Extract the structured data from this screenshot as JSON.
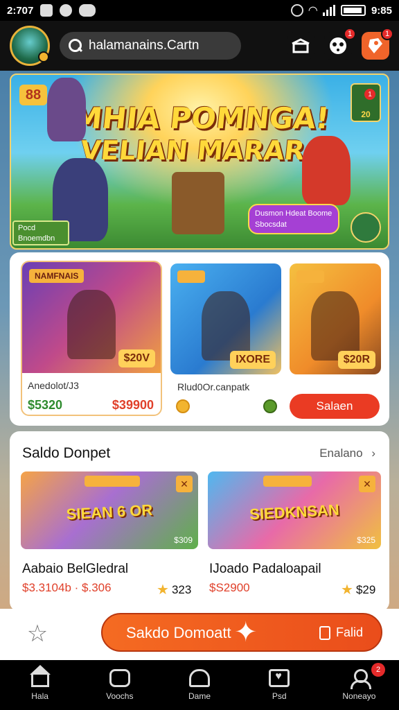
{
  "status_bar": {
    "time_left": "2:707",
    "time_right": "9:85"
  },
  "header": {
    "search_text": "halamanains.Cartn",
    "notif_badge": "1",
    "alert_badge": "1"
  },
  "hero": {
    "tag": "88",
    "title_line1": "MHIA POMNGA!",
    "title_line2": "VELIAN MARAR.",
    "corner_count": "20",
    "corner_badge": "1",
    "pill_line1": "Dusmon Hdeat Boome",
    "pill_line2": "Sbocsdat",
    "bottom_left_line1": "Pocd",
    "bottom_left_line2": "Bnoemdbn"
  },
  "shop": {
    "items": [
      {
        "ribbon": "NAMFNAIS",
        "chip": "$20V",
        "name": "Anedolot/J3",
        "price": "$5320",
        "old_price": "$39900"
      },
      {
        "ribbon": "",
        "chip": "IXORE",
        "name": "Rlud0Or.canpatk"
      },
      {
        "ribbon": "",
        "chip": "$20R"
      }
    ],
    "buy_label": "Salaen"
  },
  "section": {
    "title": "Saldo Donpet",
    "link": "Enalano",
    "tiles": [
      {
        "banner": "SIEAN 6 OR",
        "count": "$309",
        "name": "Aabaio BelGledral",
        "price": "$3.3104b · $.306",
        "rating": "323"
      },
      {
        "banner": "SIEDKNSAN",
        "count": "$325",
        "name": "IJoado Padaloapail",
        "price": "$S2900",
        "rating": "$29"
      }
    ]
  },
  "action_bar": {
    "cta_label": "Sakdo Domoatt",
    "cta_right": "Falid"
  },
  "tabbar": {
    "tabs": [
      {
        "label": "Hala"
      },
      {
        "label": "Voochs"
      },
      {
        "label": "Dame"
      },
      {
        "label": "Psd"
      },
      {
        "label": "Noneayo",
        "badge": "2"
      }
    ]
  }
}
